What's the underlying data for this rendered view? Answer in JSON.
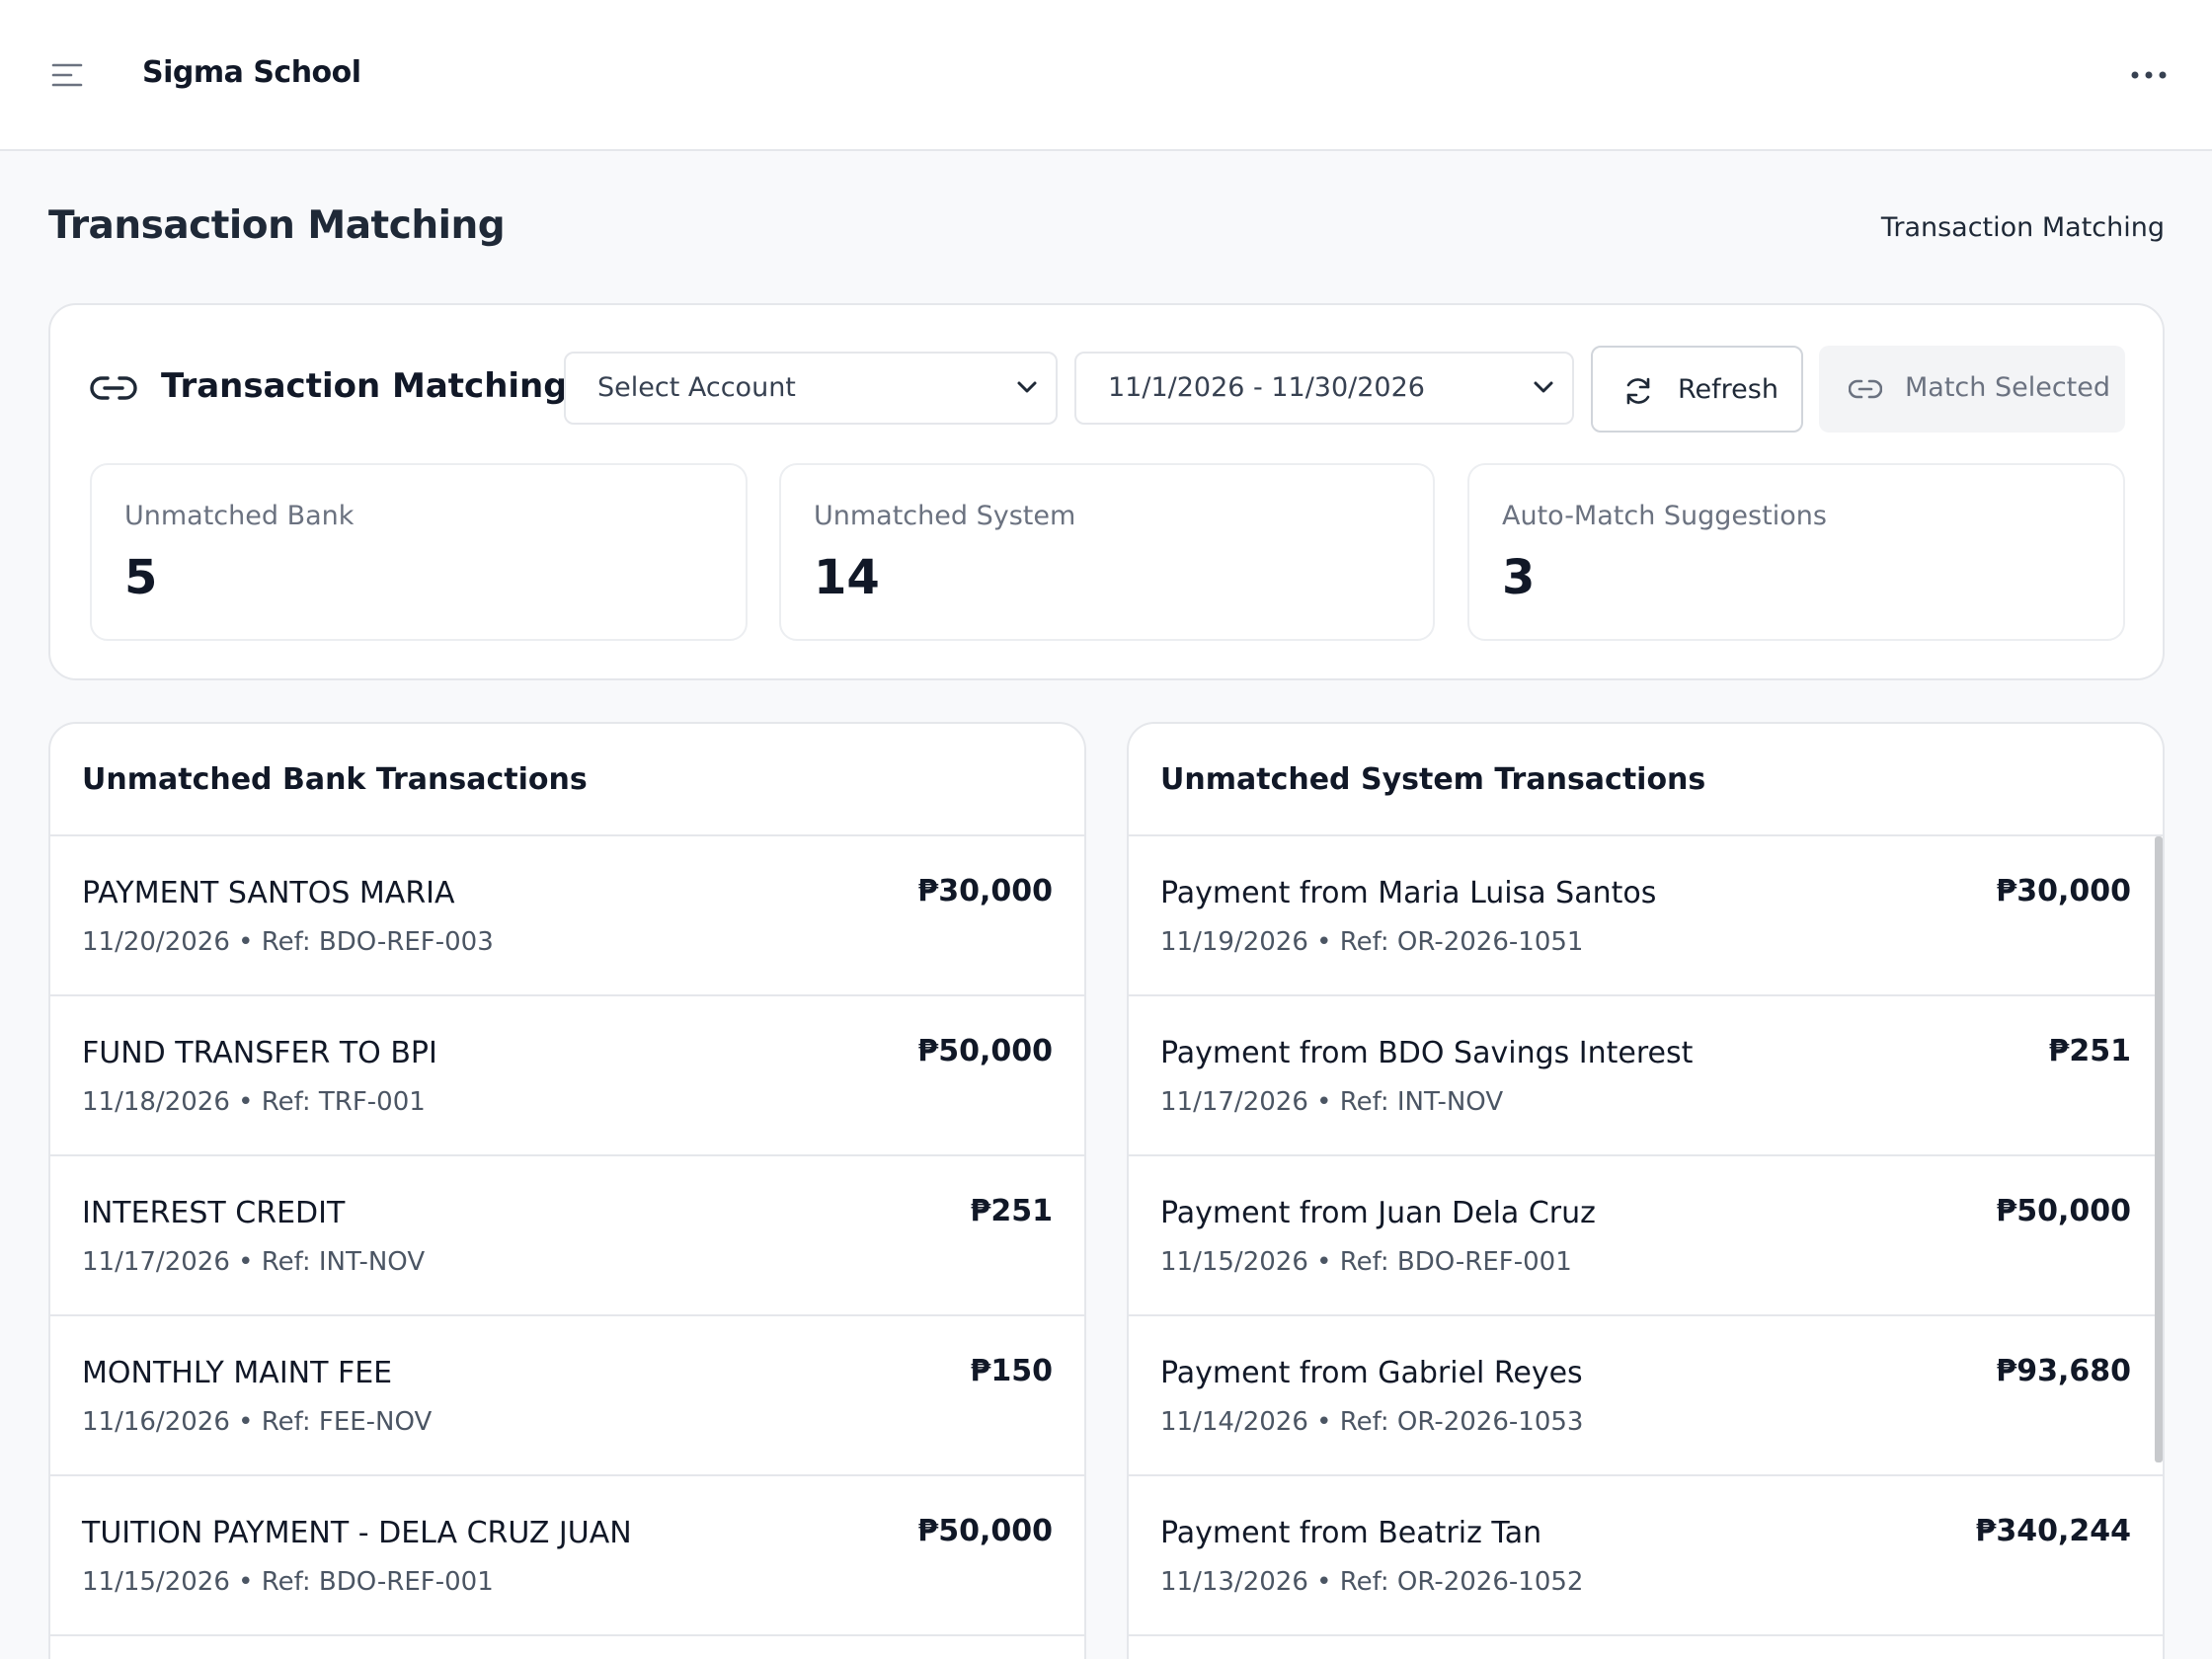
{
  "app": {
    "brand": "Sigma School"
  },
  "page": {
    "title": "Transaction Matching",
    "breadcrumb": "Transaction Matching"
  },
  "matching_card": {
    "title": "Transaction Matching",
    "account_select": "Select Account",
    "date_range": "11/1/2026 - 11/30/2026",
    "refresh_label": "Refresh",
    "match_selected_label": "Match Selected"
  },
  "stats": [
    {
      "label": "Unmatched Bank",
      "value": "5"
    },
    {
      "label": "Unmatched System",
      "value": "14"
    },
    {
      "label": "Auto-Match Suggestions",
      "value": "3"
    }
  ],
  "bank_panel": {
    "title": "Unmatched Bank Transactions",
    "rows": [
      {
        "desc": "PAYMENT SANTOS MARIA",
        "meta": "11/20/2026 • Ref: BDO-REF-003",
        "amount": "₱30,000"
      },
      {
        "desc": "FUND TRANSFER TO BPI",
        "meta": "11/18/2026 • Ref: TRF-001",
        "amount": "₱50,000"
      },
      {
        "desc": "INTEREST CREDIT",
        "meta": "11/17/2026 • Ref: INT-NOV",
        "amount": "₱251"
      },
      {
        "desc": "MONTHLY MAINT FEE",
        "meta": "11/16/2026 • Ref: FEE-NOV",
        "amount": "₱150"
      },
      {
        "desc": "TUITION PAYMENT - DELA CRUZ JUAN",
        "meta": "11/15/2026 • Ref: BDO-REF-001",
        "amount": "₱50,000"
      }
    ]
  },
  "system_panel": {
    "title": "Unmatched System Transactions",
    "rows": [
      {
        "desc": "Payment from Maria Luisa Santos",
        "meta": "11/19/2026 • Ref: OR-2026-1051",
        "amount": "₱30,000"
      },
      {
        "desc": "Payment from BDO Savings Interest",
        "meta": "11/17/2026 • Ref: INT-NOV",
        "amount": "₱251"
      },
      {
        "desc": "Payment from Juan Dela Cruz",
        "meta": "11/15/2026 • Ref: BDO-REF-001",
        "amount": "₱50,000"
      },
      {
        "desc": "Payment from Gabriel Reyes",
        "meta": "11/14/2026 • Ref: OR-2026-1053",
        "amount": "₱93,680"
      },
      {
        "desc": "Payment from Beatriz Tan",
        "meta": "11/13/2026 • Ref: OR-2026-1052",
        "amount": "₱340,244"
      }
    ]
  },
  "icons": {
    "menu": "menu-icon",
    "more": "more-horizontal-icon",
    "link": "link-icon",
    "refresh": "refresh-icon",
    "chevron": "chevron-down-icon"
  },
  "colors": {
    "background": "#f8f9fb",
    "surface": "#ffffff",
    "border": "#e5e7eb",
    "text": "#111827",
    "muted": "#6b7280"
  }
}
